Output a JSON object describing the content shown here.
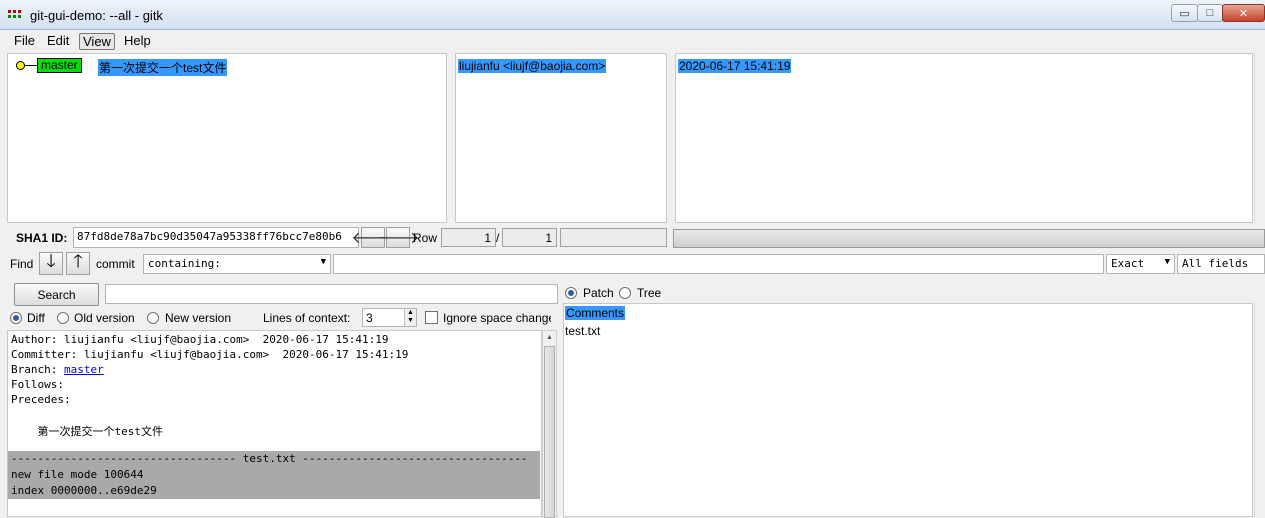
{
  "window": {
    "title": "git-gui-demo: --all - gitk",
    "min_icon": "minimize-icon",
    "max_icon": "maximize-icon",
    "close_icon": "close-icon",
    "min_glyph": "▭",
    "max_glyph": "□",
    "close_glyph": "✕"
  },
  "menu": [
    "File",
    "Edit",
    "View",
    "Help"
  ],
  "commit": {
    "branch": "master",
    "subject": "第一次提交一个test文件",
    "author": "liujianfu <liujf@baojia.com>",
    "date": "2020-06-17 15:41:19"
  },
  "sha": {
    "label": "SHA1 ID:",
    "value": "87fd8de78a7bc90d35047a95338ff76bcc7e80b6",
    "back_glyph": "🡐",
    "fwd_glyph": "🡒",
    "row_label": "Row",
    "row_current": "1",
    "row_sep": "/",
    "row_total": "1"
  },
  "find": {
    "label": "Find",
    "down_glyph": "🡓",
    "up_glyph": "🡑",
    "commit_label": "commit",
    "type_value": "containing:",
    "match_value": "Exact",
    "fields_value": "All fields",
    "caret": "▼"
  },
  "search": {
    "button_label": "Search"
  },
  "diff_options": {
    "diff": "Diff",
    "old_version": "Old version",
    "new_version": "New version",
    "context_label": "Lines of context:",
    "context_value": "3",
    "ignore_space": "Ignore space change"
  },
  "view_mode": {
    "patch": "Patch",
    "tree": "Tree"
  },
  "diff": {
    "author_line": "Author: liujianfu <liujf@baojia.com>  2020-06-17 15:41:19",
    "committer_line": "Committer: liujianfu <liujf@baojia.com>  2020-06-17 15:41:19",
    "branch_label": "Branch: ",
    "branch_link": "master",
    "follows": "Follows:",
    "precedes": "Precedes:",
    "message": "    第一次提交一个test文件",
    "file_header": "---------------------------------- test.txt ----------------------------------",
    "mode_line": "new file mode 100644",
    "index_line": "index 0000000..e69de29"
  },
  "files": {
    "comments": "Comments",
    "items": [
      "test.txt"
    ]
  },
  "colors": {
    "selection": "#3399ff",
    "branch_tag": "#00e000",
    "file_block": "#a9a9a9"
  }
}
